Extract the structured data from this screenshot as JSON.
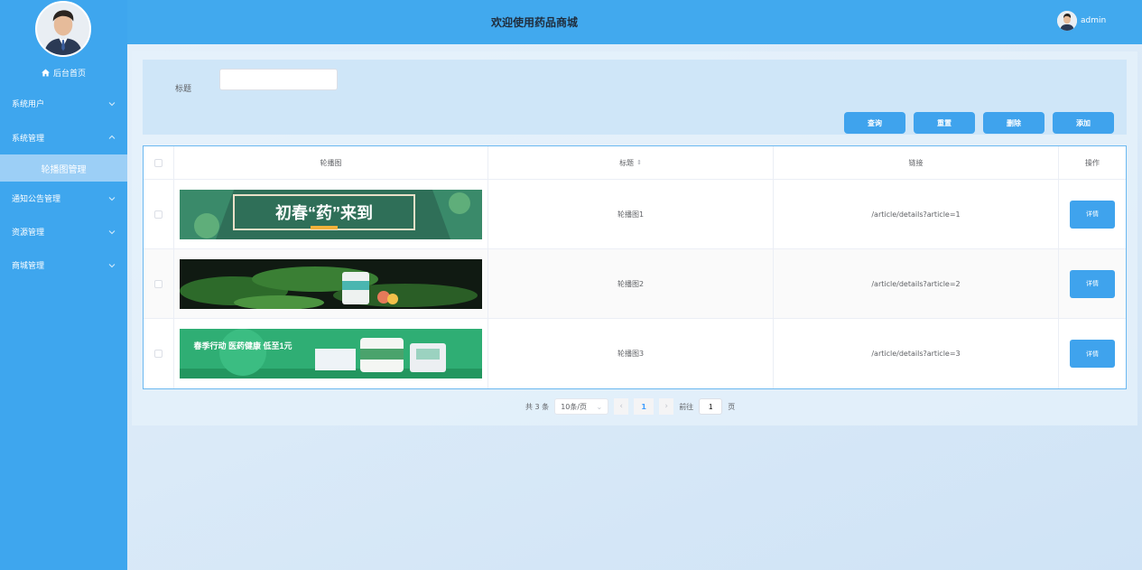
{
  "header": {
    "title": "欢迎使用药品商城",
    "username": "admin"
  },
  "sidebar": {
    "home_label": "后台首页",
    "items": [
      {
        "label": "系统用户",
        "expanded": false
      },
      {
        "label": "系统管理",
        "expanded": true
      },
      {
        "label": "通知公告管理",
        "expanded": false
      },
      {
        "label": "资源管理",
        "expanded": false
      },
      {
        "label": "商城管理",
        "expanded": false
      }
    ],
    "active_subitem": "轮播图管理"
  },
  "search": {
    "label": "标题",
    "value": "",
    "placeholder": ""
  },
  "actions": {
    "query": "查询",
    "reset": "重置",
    "delete": "删除",
    "add": "添加"
  },
  "table": {
    "headers": {
      "image": "轮播图",
      "title": "标题",
      "link": "链接",
      "op": "操作"
    },
    "rows": [
      {
        "banner_text": "初春“药”来到",
        "title": "轮播图1",
        "link": "/article/details?article=1",
        "op": "详情"
      },
      {
        "banner_text": "",
        "title": "轮播图2",
        "link": "/article/details?article=2",
        "op": "详情"
      },
      {
        "banner_text": "春季行动 医药健康 低至1元",
        "title": "轮播图3",
        "link": "/article/details?article=3",
        "op": "详情"
      }
    ]
  },
  "pagination": {
    "total": "共 3 条",
    "page_size": "10条/页",
    "current": "1",
    "goto_prefix": "前往",
    "goto_value": "1",
    "goto_suffix": "页"
  },
  "colors": {
    "sidebar": "#3ea6ee",
    "header": "#41a9ee",
    "button": "#3fa3ed",
    "submenu_active": "#9ccff6"
  }
}
